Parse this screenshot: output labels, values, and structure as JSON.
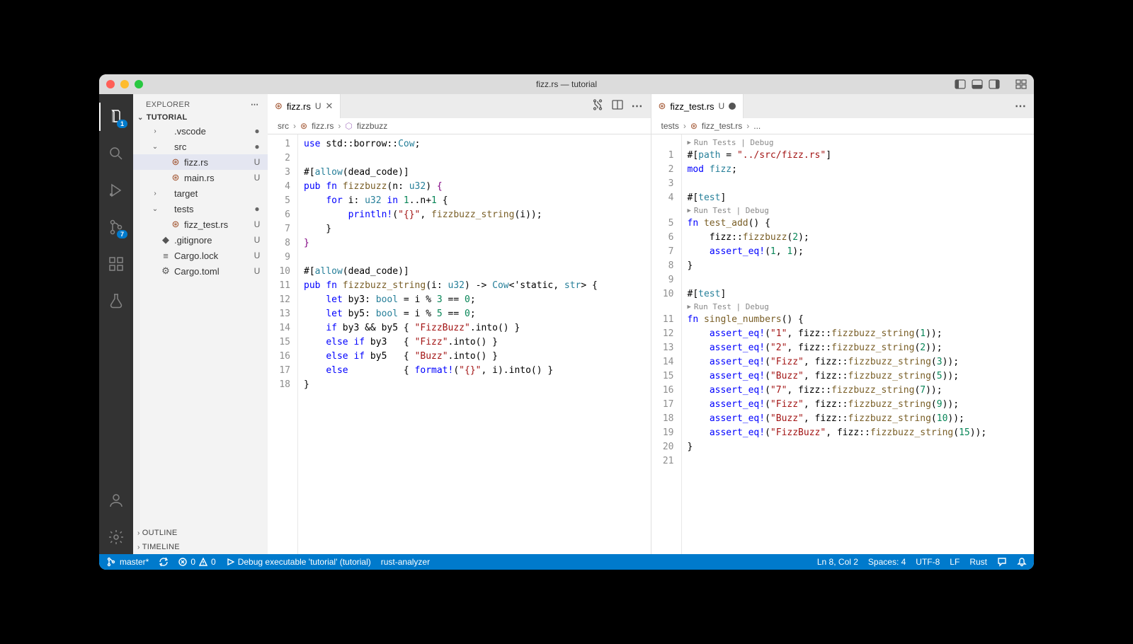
{
  "window_title": "fizz.rs — tutorial",
  "activity_badges": {
    "explorer": "1",
    "scm": "7"
  },
  "sidebar": {
    "title": "EXPLORER",
    "root": "TUTORIAL",
    "tree": [
      {
        "type": "folder",
        "name": ".vscode",
        "depth": 1,
        "collapsed": true,
        "status": "●"
      },
      {
        "type": "folder",
        "name": "src",
        "depth": 1,
        "collapsed": false,
        "status": "●"
      },
      {
        "type": "file",
        "name": "fizz.rs",
        "depth": 2,
        "icon": "rust",
        "status": "U",
        "selected": true
      },
      {
        "type": "file",
        "name": "main.rs",
        "depth": 2,
        "icon": "rust",
        "status": "U"
      },
      {
        "type": "folder",
        "name": "target",
        "depth": 1,
        "collapsed": true,
        "status": ""
      },
      {
        "type": "folder",
        "name": "tests",
        "depth": 1,
        "collapsed": false,
        "status": "●"
      },
      {
        "type": "file",
        "name": "fizz_test.rs",
        "depth": 2,
        "icon": "rust",
        "status": "U"
      },
      {
        "type": "file",
        "name": ".gitignore",
        "depth": 1,
        "icon": "git",
        "status": "U"
      },
      {
        "type": "file",
        "name": "Cargo.lock",
        "depth": 1,
        "icon": "file",
        "status": "U"
      },
      {
        "type": "file",
        "name": "Cargo.toml",
        "depth": 1,
        "icon": "gear",
        "status": "U"
      }
    ],
    "outline": "OUTLINE",
    "timeline": "TIMELINE"
  },
  "left_editor": {
    "tab": {
      "icon": "rust",
      "name": "fizz.rs",
      "status": "U"
    },
    "breadcrumbs": [
      "src",
      "fizz.rs",
      "fizzbuzz"
    ],
    "code": [
      [
        [
          "kw",
          "use"
        ],
        [
          "op",
          " std"
        ],
        [
          "op",
          "::"
        ],
        [
          "op",
          "borrow"
        ],
        [
          "op",
          "::"
        ],
        [
          "ty",
          "Cow"
        ],
        [
          "op",
          ";"
        ]
      ],
      [],
      [
        [
          "op",
          "#"
        ],
        [
          "op",
          "["
        ],
        [
          "at",
          "allow"
        ],
        [
          "op",
          "("
        ],
        [
          "op",
          "dead_code"
        ],
        [
          "op",
          ")"
        ],
        [
          "op",
          "]"
        ]
      ],
      [
        [
          "kw",
          "pub"
        ],
        [
          "op",
          " "
        ],
        [
          "kw",
          "fn"
        ],
        [
          "op",
          " "
        ],
        [
          "fn",
          "fizzbuzz"
        ],
        [
          "op",
          "("
        ],
        [
          "op",
          "n"
        ],
        [
          "op",
          ": "
        ],
        [
          "ty",
          "u32"
        ],
        [
          "op",
          ") "
        ],
        [
          "pn",
          "{"
        ]
      ],
      [
        [
          "op",
          "    "
        ],
        [
          "kw",
          "for"
        ],
        [
          "op",
          " i"
        ],
        [
          "op",
          ": "
        ],
        [
          "ty",
          "u32"
        ],
        [
          "op",
          " "
        ],
        [
          "kw",
          "in"
        ],
        [
          "op",
          " "
        ],
        [
          "nm",
          "1"
        ],
        [
          "op",
          ".."
        ],
        [
          "op",
          "n"
        ],
        [
          "op",
          "+"
        ],
        [
          "nm",
          "1"
        ],
        [
          "op",
          " {"
        ]
      ],
      [
        [
          "op",
          "        "
        ],
        [
          "mc",
          "println!"
        ],
        [
          "op",
          "("
        ],
        [
          "st",
          "\"{}\""
        ],
        [
          "op",
          ", "
        ],
        [
          "fn",
          "fizzbuzz_string"
        ],
        [
          "op",
          "(i));"
        ]
      ],
      [
        [
          "op",
          "    }"
        ]
      ],
      [
        [
          "pn",
          "}"
        ]
      ],
      [],
      [
        [
          "op",
          "#"
        ],
        [
          "op",
          "["
        ],
        [
          "at",
          "allow"
        ],
        [
          "op",
          "("
        ],
        [
          "op",
          "dead_code"
        ],
        [
          "op",
          ")"
        ],
        [
          "op",
          "]"
        ]
      ],
      [
        [
          "kw",
          "pub"
        ],
        [
          "op",
          " "
        ],
        [
          "kw",
          "fn"
        ],
        [
          "op",
          " "
        ],
        [
          "fn",
          "fizzbuzz_string"
        ],
        [
          "op",
          "("
        ],
        [
          "op",
          "i"
        ],
        [
          "op",
          ": "
        ],
        [
          "ty",
          "u32"
        ],
        [
          "op",
          ") -> "
        ],
        [
          "ty",
          "Cow"
        ],
        [
          "op",
          "<'static, "
        ],
        [
          "ty",
          "str"
        ],
        [
          "op",
          "> {"
        ]
      ],
      [
        [
          "op",
          "    "
        ],
        [
          "kw",
          "let"
        ],
        [
          "op",
          " by3"
        ],
        [
          "op",
          ": "
        ],
        [
          "ty",
          "bool"
        ],
        [
          "op",
          " = i % "
        ],
        [
          "nm",
          "3"
        ],
        [
          "op",
          " == "
        ],
        [
          "nm",
          "0"
        ],
        [
          "op",
          ";"
        ]
      ],
      [
        [
          "op",
          "    "
        ],
        [
          "kw",
          "let"
        ],
        [
          "op",
          " by5"
        ],
        [
          "op",
          ": "
        ],
        [
          "ty",
          "bool"
        ],
        [
          "op",
          " = i % "
        ],
        [
          "nm",
          "5"
        ],
        [
          "op",
          " == "
        ],
        [
          "nm",
          "0"
        ],
        [
          "op",
          ";"
        ]
      ],
      [
        [
          "op",
          "    "
        ],
        [
          "kw",
          "if"
        ],
        [
          "op",
          " by3 && by5 { "
        ],
        [
          "st",
          "\"FizzBuzz\""
        ],
        [
          "op",
          ".into() }"
        ]
      ],
      [
        [
          "op",
          "    "
        ],
        [
          "kw",
          "else"
        ],
        [
          "op",
          " "
        ],
        [
          "kw",
          "if"
        ],
        [
          "op",
          " by3   { "
        ],
        [
          "st",
          "\"Fizz\""
        ],
        [
          "op",
          ".into() }"
        ]
      ],
      [
        [
          "op",
          "    "
        ],
        [
          "kw",
          "else"
        ],
        [
          "op",
          " "
        ],
        [
          "kw",
          "if"
        ],
        [
          "op",
          " by5   { "
        ],
        [
          "st",
          "\"Buzz\""
        ],
        [
          "op",
          ".into() }"
        ]
      ],
      [
        [
          "op",
          "    "
        ],
        [
          "kw",
          "else"
        ],
        [
          "op",
          "          { "
        ],
        [
          "mc",
          "format!"
        ],
        [
          "op",
          "("
        ],
        [
          "st",
          "\"{}\""
        ],
        [
          "op",
          ", i).into() }"
        ]
      ],
      [
        [
          "op",
          "}"
        ]
      ]
    ]
  },
  "right_editor": {
    "tab": {
      "icon": "rust",
      "name": "fizz_test.rs",
      "status": "U",
      "dirty": true
    },
    "breadcrumbs": [
      "tests",
      "fizz_test.rs",
      "..."
    ],
    "codelens_top": "Run Tests | Debug",
    "codelens_each": "Run Test | Debug",
    "code": [
      [
        [
          "op",
          "#"
        ],
        [
          "op",
          "["
        ],
        [
          "at",
          "path"
        ],
        [
          "op",
          " = "
        ],
        [
          "st",
          "\"../src/fizz.rs\""
        ],
        [
          "op",
          "]"
        ]
      ],
      [
        [
          "kw",
          "mod"
        ],
        [
          "op",
          " "
        ],
        [
          "ty",
          "fizz"
        ],
        [
          "op",
          ";"
        ]
      ],
      [],
      [
        [
          "op",
          "#"
        ],
        [
          "op",
          "["
        ],
        [
          "at",
          "test"
        ],
        [
          "op",
          "]"
        ]
      ],
      "__CODELENS__",
      [
        [
          "kw",
          "fn"
        ],
        [
          "op",
          " "
        ],
        [
          "fn",
          "test_add"
        ],
        [
          "op",
          "() {"
        ]
      ],
      [
        [
          "op",
          "    fizz::"
        ],
        [
          "fn",
          "fizzbuzz"
        ],
        [
          "op",
          "("
        ],
        [
          "nm",
          "2"
        ],
        [
          "op",
          ");"
        ]
      ],
      [
        [
          "op",
          "    "
        ],
        [
          "mc",
          "assert_eq!"
        ],
        [
          "op",
          "("
        ],
        [
          "nm",
          "1"
        ],
        [
          "op",
          ", "
        ],
        [
          "nm",
          "1"
        ],
        [
          "op",
          ");"
        ]
      ],
      [
        [
          "op",
          "}"
        ]
      ],
      [],
      [
        [
          "op",
          "#"
        ],
        [
          "op",
          "["
        ],
        [
          "at",
          "test"
        ],
        [
          "op",
          "]"
        ]
      ],
      "__CODELENS__",
      [
        [
          "kw",
          "fn"
        ],
        [
          "op",
          " "
        ],
        [
          "fn",
          "single_numbers"
        ],
        [
          "op",
          "() {"
        ]
      ],
      [
        [
          "op",
          "    "
        ],
        [
          "mc",
          "assert_eq!"
        ],
        [
          "op",
          "("
        ],
        [
          "st",
          "\"1\""
        ],
        [
          "op",
          ", fizz::"
        ],
        [
          "fn",
          "fizzbuzz_string"
        ],
        [
          "op",
          "("
        ],
        [
          "nm",
          "1"
        ],
        [
          "op",
          "));"
        ]
      ],
      [
        [
          "op",
          "    "
        ],
        [
          "mc",
          "assert_eq!"
        ],
        [
          "op",
          "("
        ],
        [
          "st",
          "\"2\""
        ],
        [
          "op",
          ", fizz::"
        ],
        [
          "fn",
          "fizzbuzz_string"
        ],
        [
          "op",
          "("
        ],
        [
          "nm",
          "2"
        ],
        [
          "op",
          "));"
        ]
      ],
      [
        [
          "op",
          "    "
        ],
        [
          "mc",
          "assert_eq!"
        ],
        [
          "op",
          "("
        ],
        [
          "st",
          "\"Fizz\""
        ],
        [
          "op",
          ", fizz::"
        ],
        [
          "fn",
          "fizzbuzz_string"
        ],
        [
          "op",
          "("
        ],
        [
          "nm",
          "3"
        ],
        [
          "op",
          "));"
        ]
      ],
      [
        [
          "op",
          "    "
        ],
        [
          "mc",
          "assert_eq!"
        ],
        [
          "op",
          "("
        ],
        [
          "st",
          "\"Buzz\""
        ],
        [
          "op",
          ", fizz::"
        ],
        [
          "fn",
          "fizzbuzz_string"
        ],
        [
          "op",
          "("
        ],
        [
          "nm",
          "5"
        ],
        [
          "op",
          "));"
        ]
      ],
      [
        [
          "op",
          "    "
        ],
        [
          "mc",
          "assert_eq!"
        ],
        [
          "op",
          "("
        ],
        [
          "st",
          "\"7\""
        ],
        [
          "op",
          ", fizz::"
        ],
        [
          "fn",
          "fizzbuzz_string"
        ],
        [
          "op",
          "("
        ],
        [
          "nm",
          "7"
        ],
        [
          "op",
          "));"
        ]
      ],
      [
        [
          "op",
          "    "
        ],
        [
          "mc",
          "assert_eq!"
        ],
        [
          "op",
          "("
        ],
        [
          "st",
          "\"Fizz\""
        ],
        [
          "op",
          ", fizz::"
        ],
        [
          "fn",
          "fizzbuzz_string"
        ],
        [
          "op",
          "("
        ],
        [
          "nm",
          "9"
        ],
        [
          "op",
          "));"
        ]
      ],
      [
        [
          "op",
          "    "
        ],
        [
          "mc",
          "assert_eq!"
        ],
        [
          "op",
          "("
        ],
        [
          "st",
          "\"Buzz\""
        ],
        [
          "op",
          ", fizz::"
        ],
        [
          "fn",
          "fizzbuzz_string"
        ],
        [
          "op",
          "("
        ],
        [
          "nm",
          "10"
        ],
        [
          "op",
          "));"
        ]
      ],
      [
        [
          "op",
          "    "
        ],
        [
          "mc",
          "assert_eq!"
        ],
        [
          "op",
          "("
        ],
        [
          "st",
          "\"FizzBuzz\""
        ],
        [
          "op",
          ", fizz::"
        ],
        [
          "fn",
          "fizzbuzz_string"
        ],
        [
          "op",
          "("
        ],
        [
          "nm",
          "15"
        ],
        [
          "op",
          "));"
        ]
      ],
      [
        [
          "op",
          "}"
        ]
      ],
      []
    ]
  },
  "statusbar": {
    "branch": "master*",
    "errors": "0",
    "warnings": "0",
    "debug": "Debug executable 'tutorial' (tutorial)",
    "lsp": "rust-analyzer",
    "cursor": "Ln 8, Col 2",
    "spaces": "Spaces: 4",
    "encoding": "UTF-8",
    "eol": "LF",
    "language": "Rust"
  }
}
